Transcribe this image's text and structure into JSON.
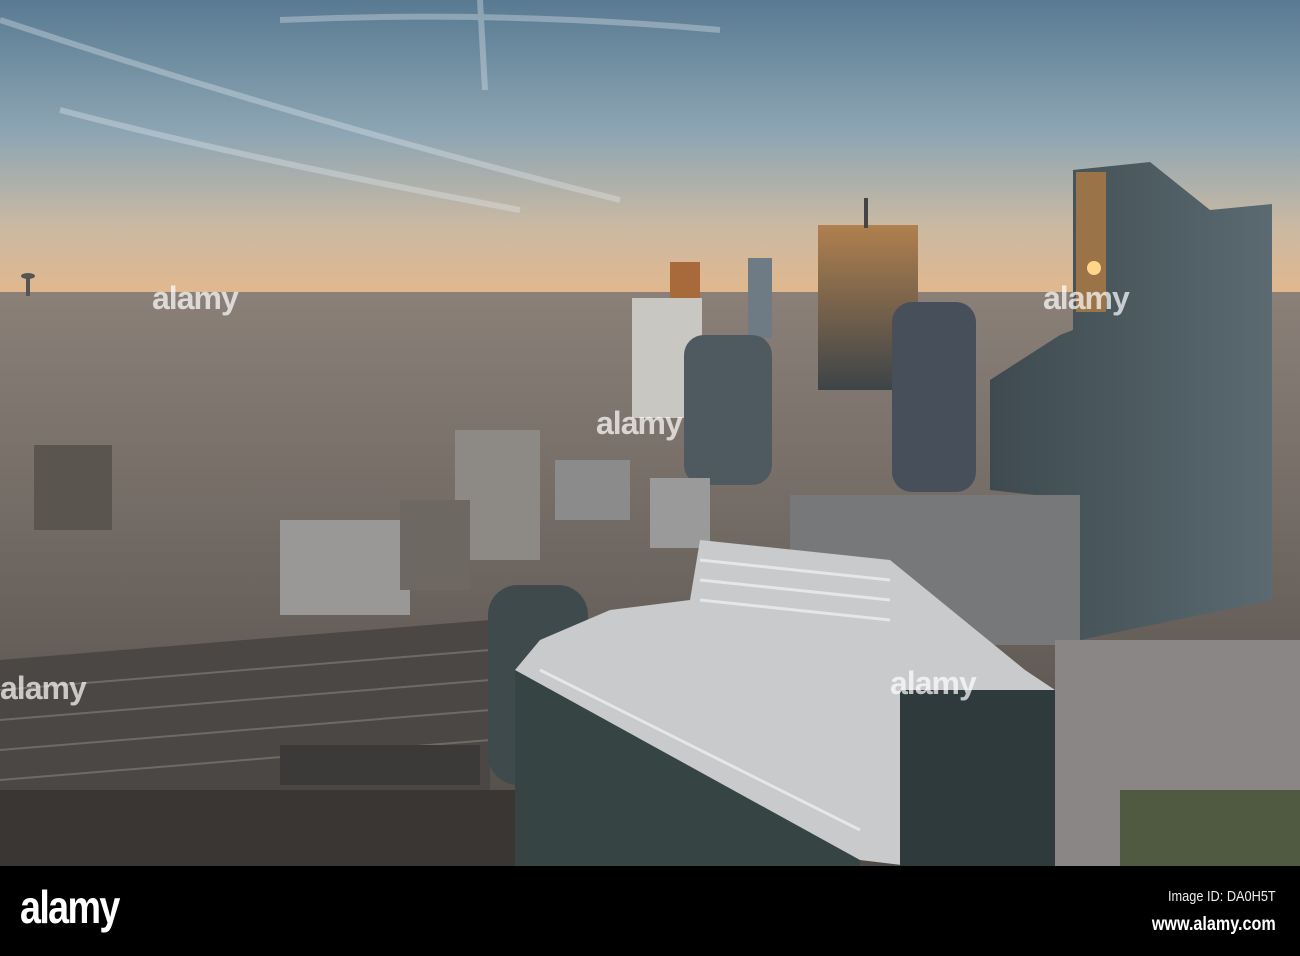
{
  "watermark": {
    "brand": "alamy",
    "image_id": "Image ID: DA0H5T",
    "url": "www.alamy.com"
  },
  "colors": {
    "sky_top": "#5d7d93",
    "sky_glow": "#e2b88c",
    "city": "#6a645e",
    "bar": "#000000"
  }
}
